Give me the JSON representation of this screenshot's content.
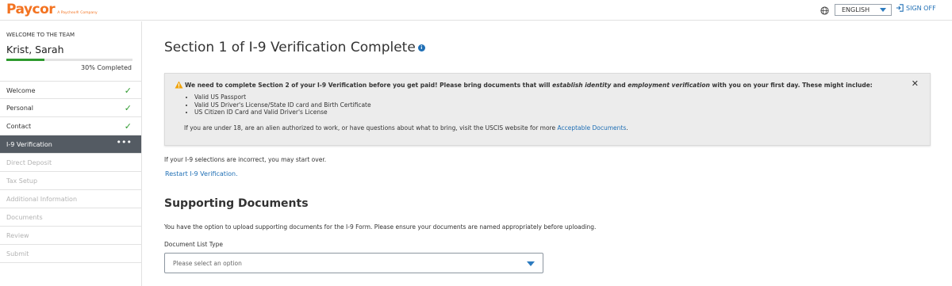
{
  "header": {
    "logo_main": "Paycor",
    "logo_sub": "A Paychex® Company",
    "language": "ENGLISH",
    "sign_off": "SIGN OFF"
  },
  "sidebar": {
    "welcome_label": "WELCOME TO THE TEAM",
    "user_name": "Krist, Sarah",
    "progress_percent": 30,
    "progress_text": "30% Completed",
    "items": [
      {
        "label": "Welcome",
        "state": "complete"
      },
      {
        "label": "Personal",
        "state": "complete"
      },
      {
        "label": "Contact",
        "state": "complete"
      },
      {
        "label": "I-9 Verification",
        "state": "active"
      },
      {
        "label": "Direct Deposit",
        "state": "disabled"
      },
      {
        "label": "Tax Setup",
        "state": "disabled"
      },
      {
        "label": "Additional Information",
        "state": "disabled"
      },
      {
        "label": "Documents",
        "state": "disabled"
      },
      {
        "label": "Review",
        "state": "disabled"
      },
      {
        "label": "Submit",
        "state": "disabled"
      }
    ]
  },
  "main": {
    "title": "Section 1 of I-9 Verification Complete",
    "alert": {
      "head_pre": "We need to complete Section 2 of your I-9 Verification before you get paid! Please bring documents that will ",
      "head_em1": "establish identity",
      "head_mid": " and ",
      "head_em2": "employment verification",
      "head_post": " with you on your first day. These might include:",
      "items": [
        "Valid US Passport",
        "Valid US Driver's License/State ID card and Birth Certificate",
        "US Citizen ID Card and Valid Driver's License"
      ],
      "foot_text": "If you are under 18, are an alien authorized to work, or have questions about what to bring, visit the USCIS website for more ",
      "foot_link": "Acceptable Documents",
      "foot_end": "."
    },
    "restart_note": "If your I-9 selections are incorrect, you may start over.",
    "restart_link": "Restart I-9 Verification.",
    "supporting": {
      "title": "Supporting Documents",
      "text": "You have the option to upload supporting documents for the I-9 Form. Please ensure your documents are named appropriately before uploading.",
      "field_label": "Document List Type",
      "placeholder": "Please select an option"
    }
  },
  "colors": {
    "brand": "#f37321",
    "link": "#1f6fb5",
    "success": "#2e9a2e",
    "active_nav": "#545b63",
    "warning": "#f0a30a"
  }
}
